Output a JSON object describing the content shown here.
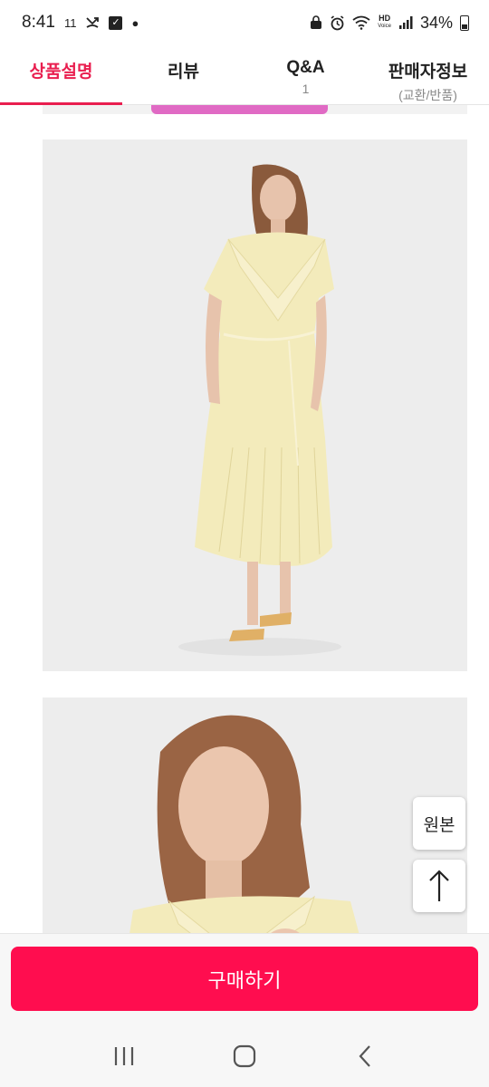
{
  "status_bar": {
    "time": "8:41",
    "notif_text": "11",
    "hd_label": "HD",
    "hd_sub": "Voice",
    "battery": "34%"
  },
  "tabs": [
    {
      "label": "상품설명",
      "sub": "",
      "active": true
    },
    {
      "label": "리뷰",
      "sub": ""
    },
    {
      "label": "Q&A",
      "sub": "1"
    },
    {
      "label": "판매자정보",
      "sub": "(교환/반품)"
    }
  ],
  "floating": {
    "original_label": "원본",
    "scroll_top_icon": "arrow-up-icon"
  },
  "buy_button_label": "구매하기",
  "colors": {
    "accent": "#e91e4f",
    "buy_button": "#ff0d4f",
    "dress": "#f3ebbb",
    "photo_bg": "#ededed"
  },
  "nav": {
    "recent_icon": "recent-apps-icon",
    "home_icon": "home-icon",
    "back_icon": "back-icon"
  }
}
